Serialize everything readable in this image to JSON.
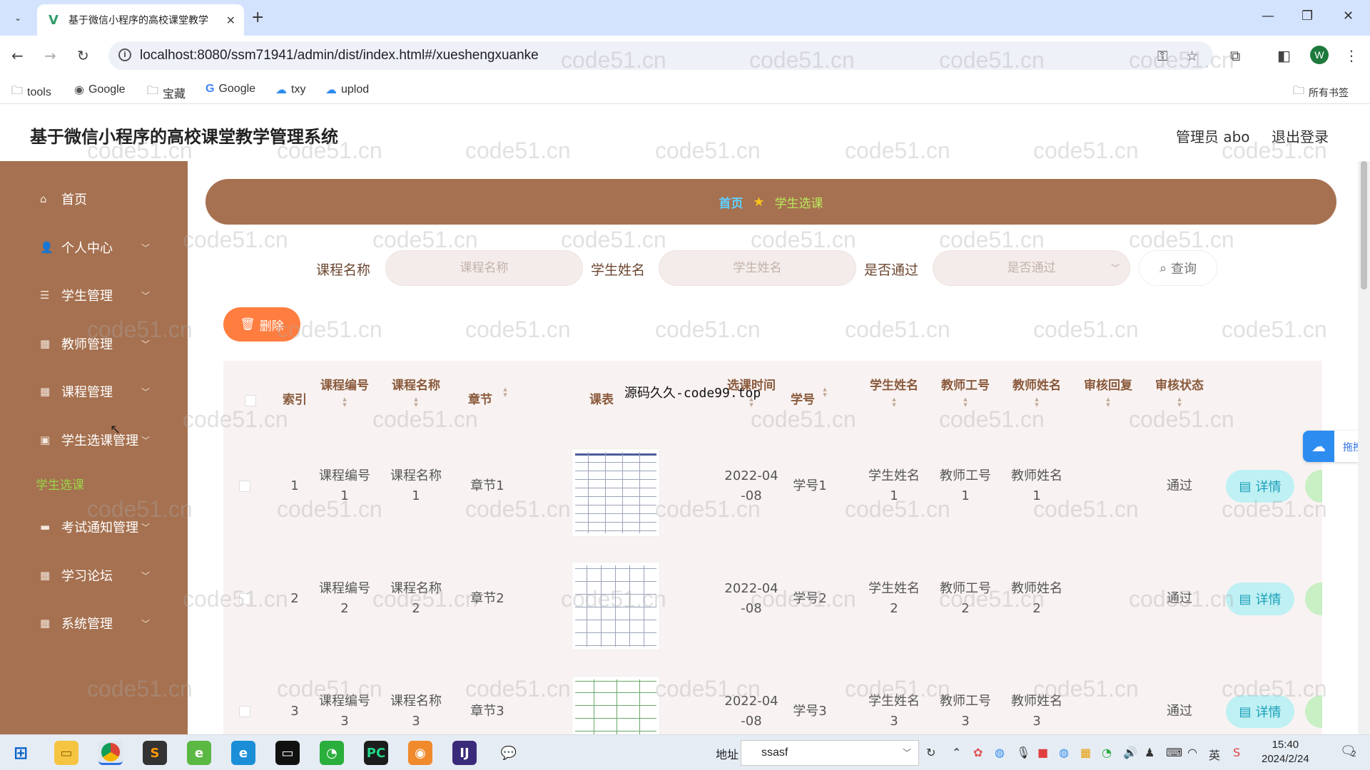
{
  "browser": {
    "tab_title": "基于微信小程序的高校课堂教学",
    "url": "localhost:8080/ssm71941/admin/dist/index.html#/xueshengxuanke",
    "bookmarks": [
      {
        "label": "tools",
        "icon": "folder-icon"
      },
      {
        "label": "Google",
        "icon": "globe-icon"
      },
      {
        "label": "宝藏",
        "icon": "folder-icon"
      },
      {
        "label": "Google",
        "icon": "google-icon"
      },
      {
        "label": "txy",
        "icon": "cloud-icon"
      },
      {
        "label": "uplod",
        "icon": "cloud-icon"
      }
    ],
    "all_bookmarks": "所有书签",
    "profile_initial": "W"
  },
  "header": {
    "title": "基于微信小程序的高校课堂教学管理系统",
    "user": "管理员 abo",
    "logout": "退出登录"
  },
  "sidebar": {
    "items": [
      {
        "label": "首页",
        "icon": "home-icon",
        "arrow": false
      },
      {
        "label": "个人中心",
        "icon": "user-icon",
        "arrow": true
      },
      {
        "label": "学生管理",
        "icon": "list-icon",
        "arrow": true
      },
      {
        "label": "教师管理",
        "icon": "grid-icon",
        "arrow": true
      },
      {
        "label": "课程管理",
        "icon": "grid-icon",
        "arrow": true
      },
      {
        "label": "学生选课管理",
        "icon": "image-icon",
        "arrow": true
      },
      {
        "label": "考试通知管理",
        "icon": "bag-icon",
        "arrow": true
      },
      {
        "label": "学习论坛",
        "icon": "grid-icon",
        "arrow": true
      },
      {
        "label": "系统管理",
        "icon": "grid-icon",
        "arrow": true
      }
    ],
    "active_sub": "学生选课"
  },
  "breadcrumb": {
    "home": "首页",
    "current": "学生选课"
  },
  "search": {
    "course_label": "课程名称",
    "course_placeholder": "课程名称",
    "student_label": "学生姓名",
    "student_placeholder": "学生姓名",
    "passed_label": "是否通过",
    "passed_placeholder": "是否通过",
    "query_button": "查询"
  },
  "actions": {
    "delete_button": "删除"
  },
  "table": {
    "headers": {
      "index": "索引",
      "course_no": "课程编号",
      "course_name": "课程名称",
      "chapter": "章节",
      "schedule": "课表",
      "select_time": "选课时间",
      "student_no": "学号",
      "student_name": "学生姓名",
      "teacher_no": "教师工号",
      "teacher_name": "教师姓名",
      "review_reply": "审核回复",
      "review_status": "审核状态"
    },
    "rows": [
      {
        "index": "1",
        "course_no_a": "课程编号",
        "course_no_b": "1",
        "course_name_a": "课程名称",
        "course_name_b": "1",
        "chapter": "章节1",
        "time_a": "2022-04",
        "time_b": "-08",
        "student_no": "学号1",
        "student_name_a": "学生姓名",
        "student_name_b": "1",
        "teacher_no_a": "教师工号",
        "teacher_no_b": "1",
        "teacher_name_a": "教师姓名",
        "teacher_name_b": "1",
        "review_reply": "",
        "status": "通过",
        "detail": "详情"
      },
      {
        "index": "2",
        "course_no_a": "课程编号",
        "course_no_b": "2",
        "course_name_a": "课程名称",
        "course_name_b": "2",
        "chapter": "章节2",
        "time_a": "2022-04",
        "time_b": "-08",
        "student_no": "学号2",
        "student_name_a": "学生姓名",
        "student_name_b": "2",
        "teacher_no_a": "教师工号",
        "teacher_no_b": "2",
        "teacher_name_a": "教师姓名",
        "teacher_name_b": "2",
        "review_reply": "",
        "status": "通过",
        "detail": "详情"
      },
      {
        "index": "3",
        "course_no_a": "课程编号",
        "course_no_b": "3",
        "course_name_a": "课程名称",
        "course_name_b": "3",
        "chapter": "章节3",
        "time_a": "2022-04",
        "time_b": "-08",
        "student_no": "学号3",
        "student_name_a": "学生姓名",
        "student_name_b": "3",
        "teacher_no_a": "教师工号",
        "teacher_no_b": "3",
        "teacher_name_a": "教师姓名",
        "teacher_name_b": "3",
        "review_reply": "",
        "status": "通过",
        "detail": "详情"
      }
    ]
  },
  "overlay_text": "源码久久-code99.top",
  "float_widget": "拖拽至",
  "watermark": "code51.cn",
  "taskbar": {
    "address_label": "地址",
    "address_value": "ssasf",
    "ime": "英",
    "time": "15:40",
    "date": "2024/2/24",
    "notification_count": "2"
  },
  "colors": {
    "sidebar": "#a67150",
    "active_sub": "#9ad548",
    "delete": "#ff7d3f",
    "detail": "#bff0f4"
  }
}
